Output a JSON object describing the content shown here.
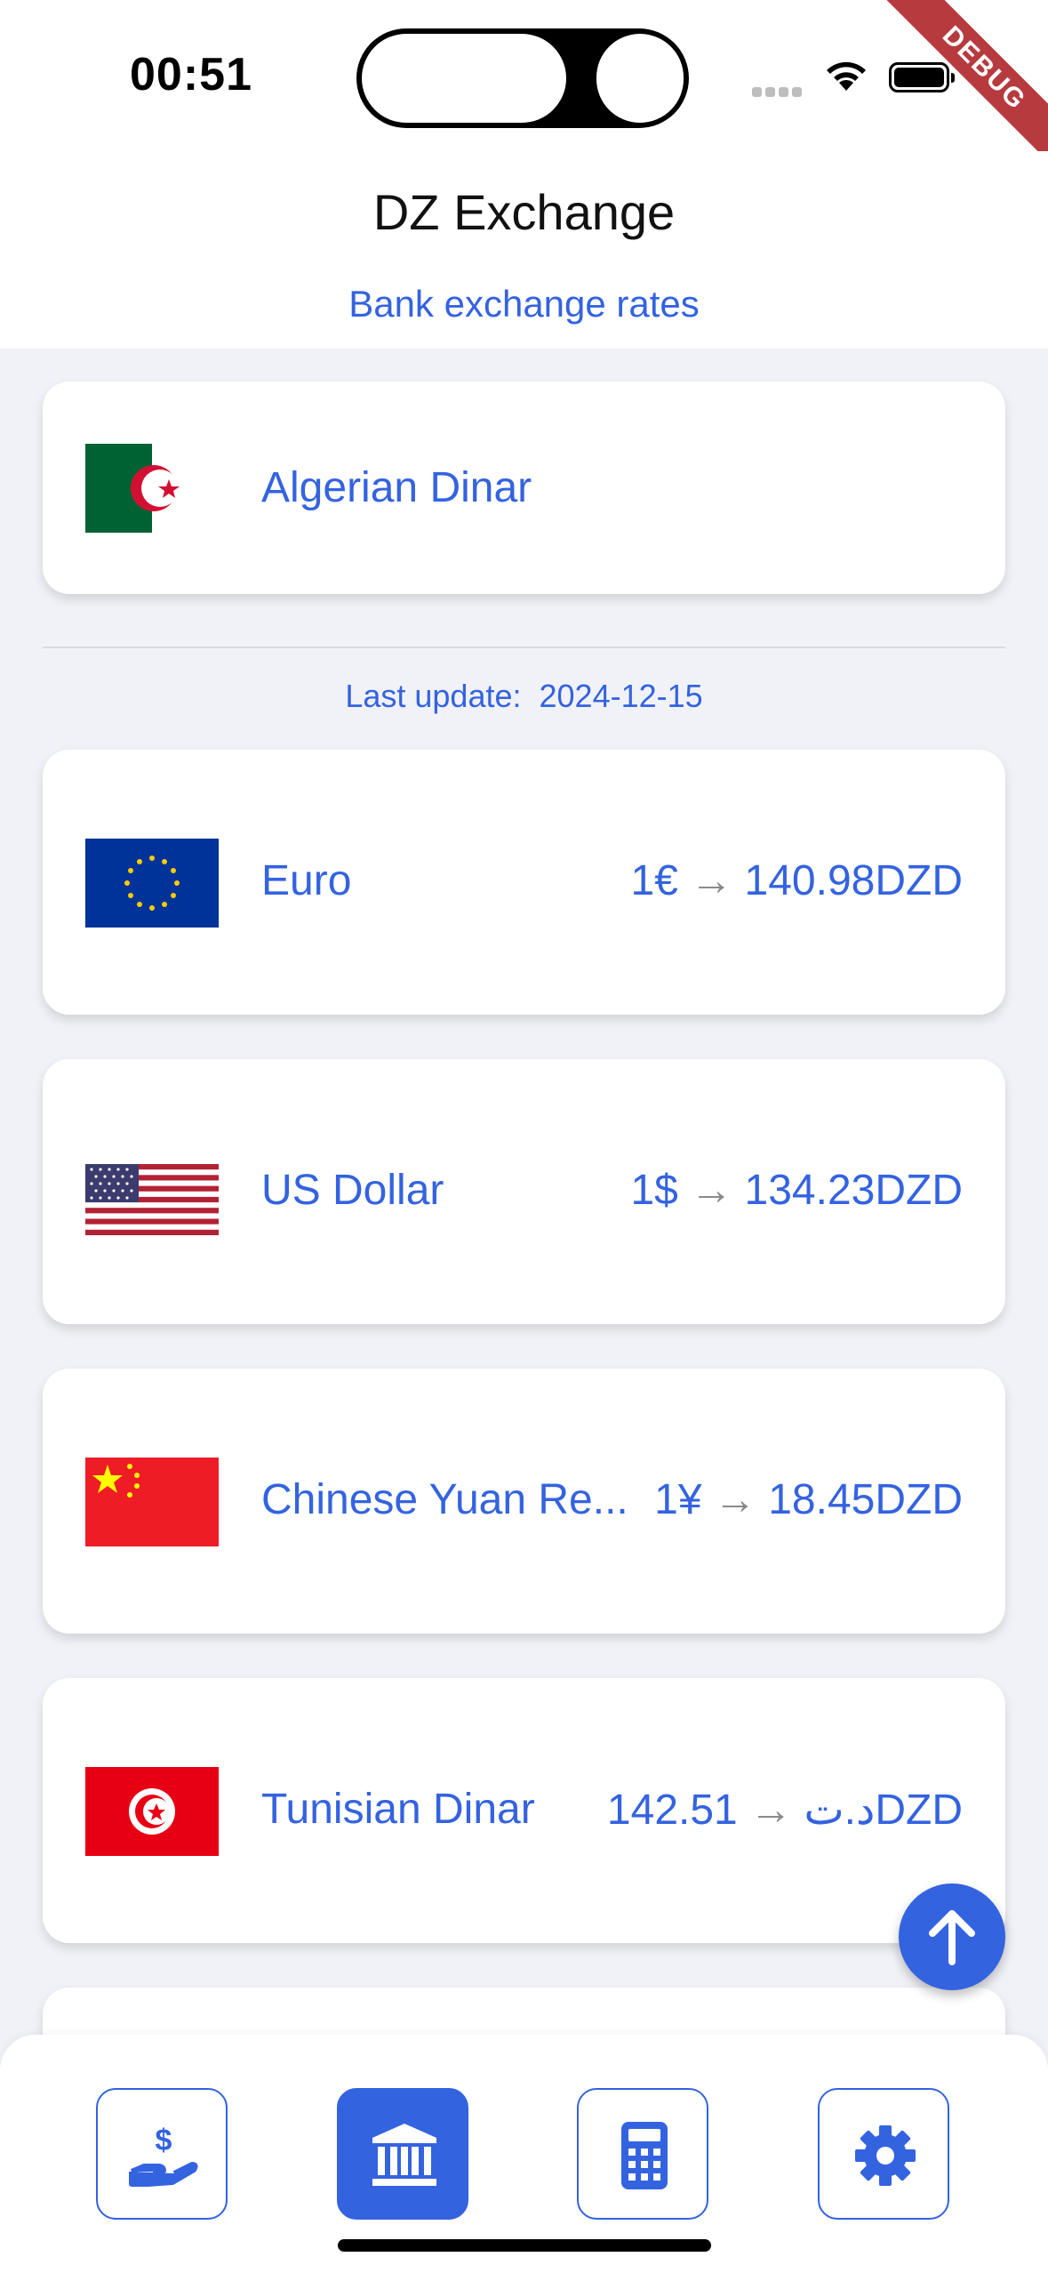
{
  "status_bar": {
    "time": "00:51"
  },
  "debug_banner": "DEBUG",
  "header": {
    "title": "DZ Exchange",
    "subtitle": "Bank exchange rates"
  },
  "base_currency": {
    "name": "Algerian Dinar",
    "flag_icon": "algeria-flag-icon"
  },
  "last_update": {
    "label": "Last update:",
    "date": "2024-12-15"
  },
  "rates": [
    {
      "name": "Euro",
      "base": "1€",
      "arrow": "→",
      "value": "140.98DZD",
      "flag_icon": "eu-flag-icon"
    },
    {
      "name": "US Dollar",
      "base": "1$",
      "arrow": "→",
      "value": "134.23DZD",
      "flag_icon": "us-flag-icon"
    },
    {
      "name": "Chinese Yuan Re...",
      "base": "1¥",
      "arrow": "→",
      "value": "18.45DZD",
      "flag_icon": "china-flag-icon"
    },
    {
      "name": "Tunisian Dinar",
      "base": "1د.ت",
      "arrow": "→",
      "value": "42.51DZD",
      "flag_icon": "tunisia-flag-icon"
    }
  ],
  "nav": [
    {
      "icon": "money-hand-icon",
      "active": false
    },
    {
      "icon": "bank-icon",
      "active": true
    },
    {
      "icon": "calculator-icon",
      "active": false
    },
    {
      "icon": "gear-icon",
      "active": false
    }
  ],
  "colors": {
    "accent": "#3463E0",
    "background": "#F1F2F7",
    "arrow": "#8A8A8A",
    "debug": "#B73B3E"
  }
}
